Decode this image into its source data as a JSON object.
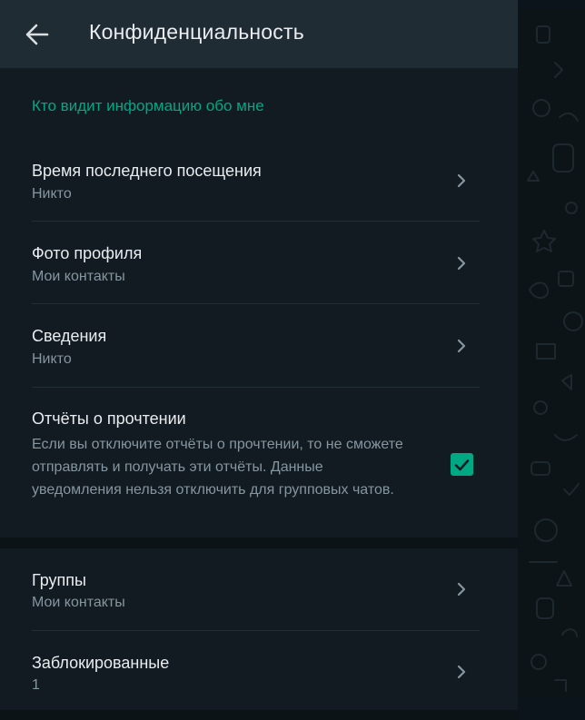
{
  "header": {
    "title": "Конфиденциальность",
    "back_icon": "arrow-left-icon"
  },
  "section": {
    "title": "Кто видит информацию обо мне"
  },
  "items": [
    {
      "label": "Время последнего посещения",
      "value": "Никто"
    },
    {
      "label": "Фото профиля",
      "value": "Мои контакты"
    },
    {
      "label": "Сведения",
      "value": "Никто"
    }
  ],
  "read_receipts": {
    "label": "Отчёты о прочтении",
    "description": "Если вы отключите отчёты о прочтении, то не сможете отправлять и получать эти отчёты. Данные уведомления нельзя отключить для групповых чатов.",
    "checked": true
  },
  "items2": [
    {
      "label": "Группы",
      "value": "Мои контакты"
    },
    {
      "label": "Заблокированные",
      "value": "1"
    }
  ],
  "colors": {
    "accent": "#00a884",
    "panel_bg": "#111b21",
    "header_bg": "#202c33",
    "primary_text": "#e9edef",
    "secondary_text": "#8696a0"
  }
}
